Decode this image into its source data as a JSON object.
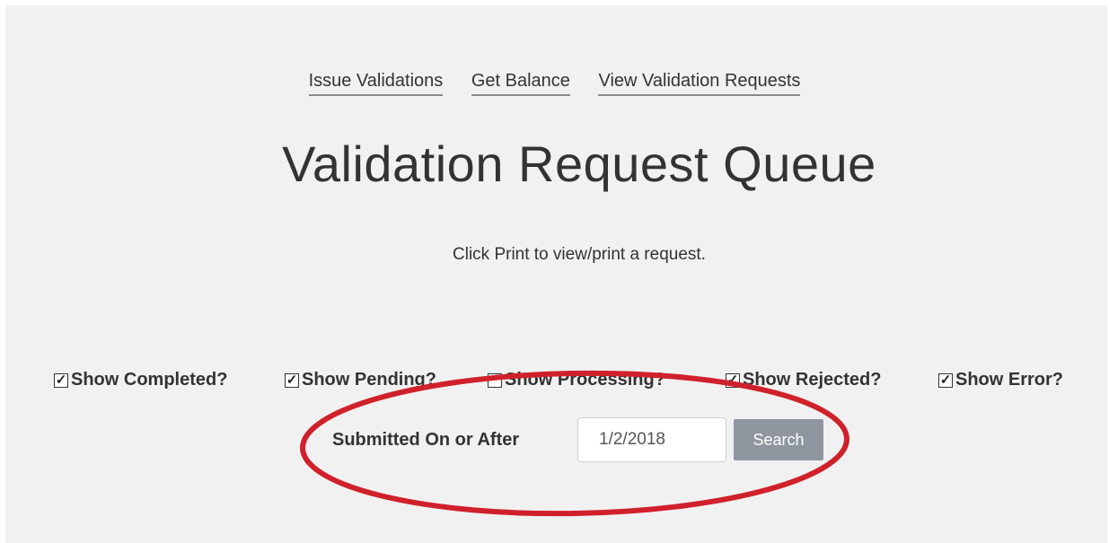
{
  "nav": {
    "links": [
      "Issue Validations",
      "Get Balance",
      "View Validation Requests"
    ]
  },
  "page": {
    "title": "Validation Request Queue",
    "instructions": "Click Print to view/print a request."
  },
  "filters": [
    {
      "label": "Show Completed?",
      "checked": true
    },
    {
      "label": "Show Pending?",
      "checked": true
    },
    {
      "label": "Show Processing?",
      "checked": false
    },
    {
      "label": "Show Rejected?",
      "checked": true
    },
    {
      "label": "Show Error?",
      "checked": true
    }
  ],
  "date_filter": {
    "label": "Submitted On or After",
    "value": "1/2/2018",
    "button_label": "Search"
  },
  "colors": {
    "annotation": "#d0212b",
    "background": "#f1f1f1",
    "button": "#8f96a0"
  },
  "icons": {
    "checkbox_checked": "check-icon"
  }
}
